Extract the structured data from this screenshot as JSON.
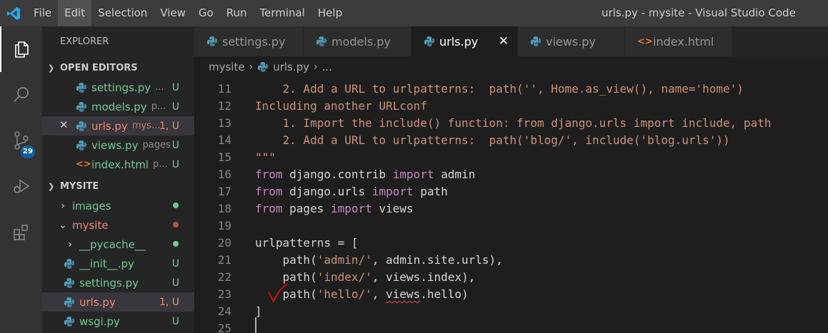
{
  "window": {
    "title": "urls.py - mysite - Visual Studio Code"
  },
  "menu": [
    "File",
    "Edit",
    "Selection",
    "View",
    "Go",
    "Run",
    "Terminal",
    "Help"
  ],
  "activity_bar": {
    "source_control_badge": "29"
  },
  "explorer": {
    "title": "EXPLORER",
    "open_editors_label": "OPEN EDITORS",
    "open_editors": [
      {
        "name": "settings.py",
        "desc": "...",
        "status": "U"
      },
      {
        "name": "models.py",
        "desc": "p...",
        "status": "U"
      },
      {
        "name": "urls.py",
        "desc": "mys...",
        "status": "1, U"
      },
      {
        "name": "views.py",
        "desc": "pages",
        "status": "U"
      },
      {
        "name": "index.html",
        "desc": "p...",
        "status": "U"
      }
    ],
    "project_label": "MYSITE",
    "tree": [
      {
        "name": "images"
      },
      {
        "name": "mysite"
      },
      {
        "name": "__pycache__"
      },
      {
        "name": "__init__.py",
        "status": "U"
      },
      {
        "name": "settings.py",
        "status": "U"
      },
      {
        "name": "urls.py",
        "status": "1, U"
      },
      {
        "name": "wsgi.py",
        "status": "U"
      }
    ]
  },
  "tabs": [
    {
      "label": "settings.py"
    },
    {
      "label": "models.py"
    },
    {
      "label": "urls.py"
    },
    {
      "label": "views.py"
    },
    {
      "label": "index.html"
    }
  ],
  "breadcrumb": {
    "folder": "mysite",
    "file": "urls.py",
    "more": "..."
  },
  "editor": {
    "line_numbers": [
      "11",
      "12",
      "13",
      "14",
      "15",
      "16",
      "17",
      "18",
      "19",
      "20",
      "21",
      "22",
      "23",
      "24",
      "25"
    ],
    "lines": [
      "    2. Add a URL to urlpatterns:  path('', Home.as_view(), name='home')",
      "Including another URLconf",
      "    1. Import the include() function: from django.urls import include, path",
      "    2. Add a URL to urlpatterns:  path('blog/', include('blog.urls'))",
      "\"\"\"",
      "from django.contrib import admin",
      "from django.urls import path",
      "from pages import views",
      "",
      "urlpatterns = [",
      "    path('admin/', admin.site.urls),",
      "    path('index/', views.index),",
      "    path('hello/', views.hello)",
      "]",
      ""
    ]
  },
  "colors": {
    "accent": "#007acc",
    "untracked_green": "#73c991",
    "error_red": "#f48771",
    "string_orange": "#ce9178",
    "keyword_purple": "#c586c0",
    "annotation_red": "#e51400"
  }
}
